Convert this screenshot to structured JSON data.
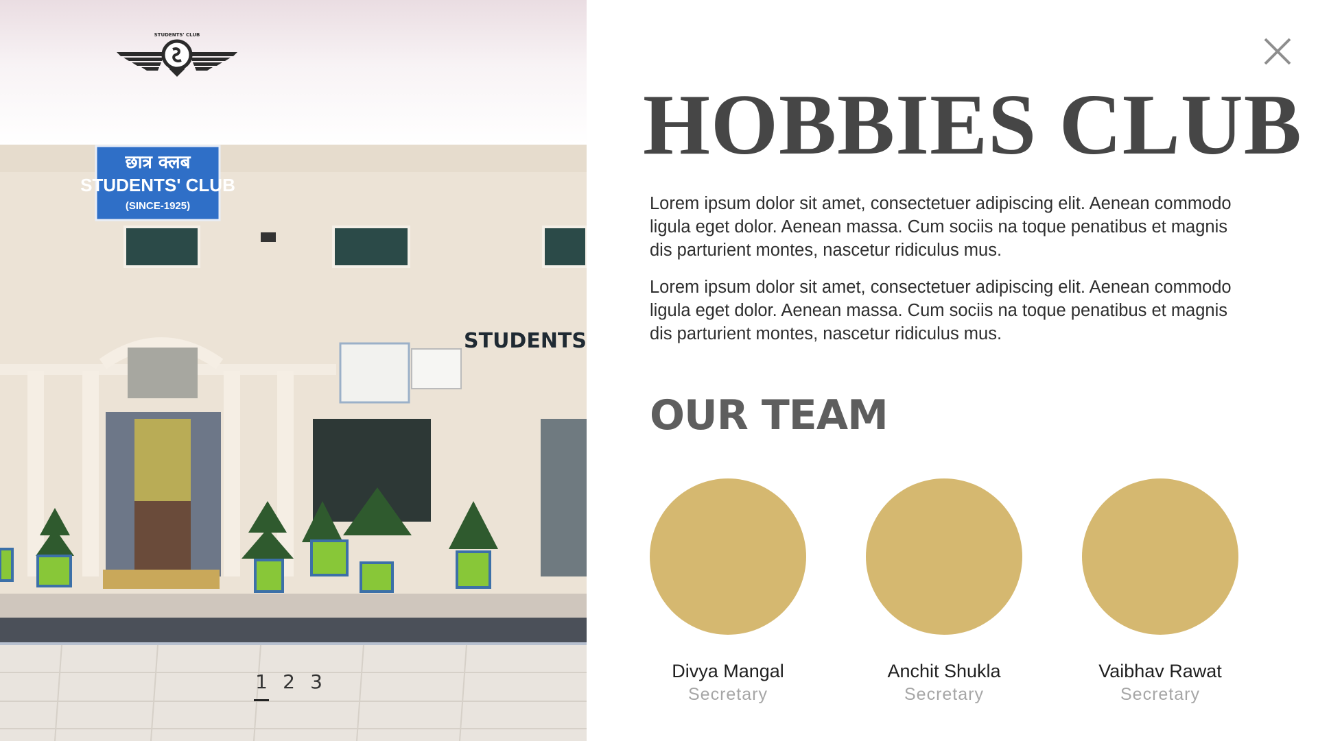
{
  "logo": {
    "icon": "students-club-winged-emblem",
    "text": "STUDENTS' CLUB"
  },
  "photo": {
    "sign_hindi": "छात्र क्लब",
    "sign_title": "STUDENTS' CLUB",
    "sign_since": "(SINCE-1925)",
    "wall_lettering": "STUDENTS C"
  },
  "pager": {
    "pages": [
      "1",
      "2",
      "3"
    ],
    "active": "1"
  },
  "close": {
    "icon": "close-icon"
  },
  "content": {
    "title": "HOBBIES CLUB",
    "paragraphs": [
      "Lorem ipsum dolor sit amet, consectetuer adipiscing elit. Aenean commodo ligula eget dolor. Aenean massa. Cum sociis na toque penatibus et magnis dis parturient montes, nascetur ridiculus mus.",
      "Lorem ipsum dolor sit amet, consectetuer adipiscing elit. Aenean commodo ligula eget dolor. Aenean massa. Cum sociis na toque penatibus et magnis dis parturient montes, nascetur ridiculus mus."
    ]
  },
  "team": {
    "heading": "OUR TEAM",
    "avatar_color": "#d5b870",
    "members": [
      {
        "name": "Divya Mangal",
        "role": "Secretary"
      },
      {
        "name": "Anchit Shukla",
        "role": "Secretary"
      },
      {
        "name": "Vaibhav Rawat",
        "role": "Secretary"
      }
    ]
  }
}
